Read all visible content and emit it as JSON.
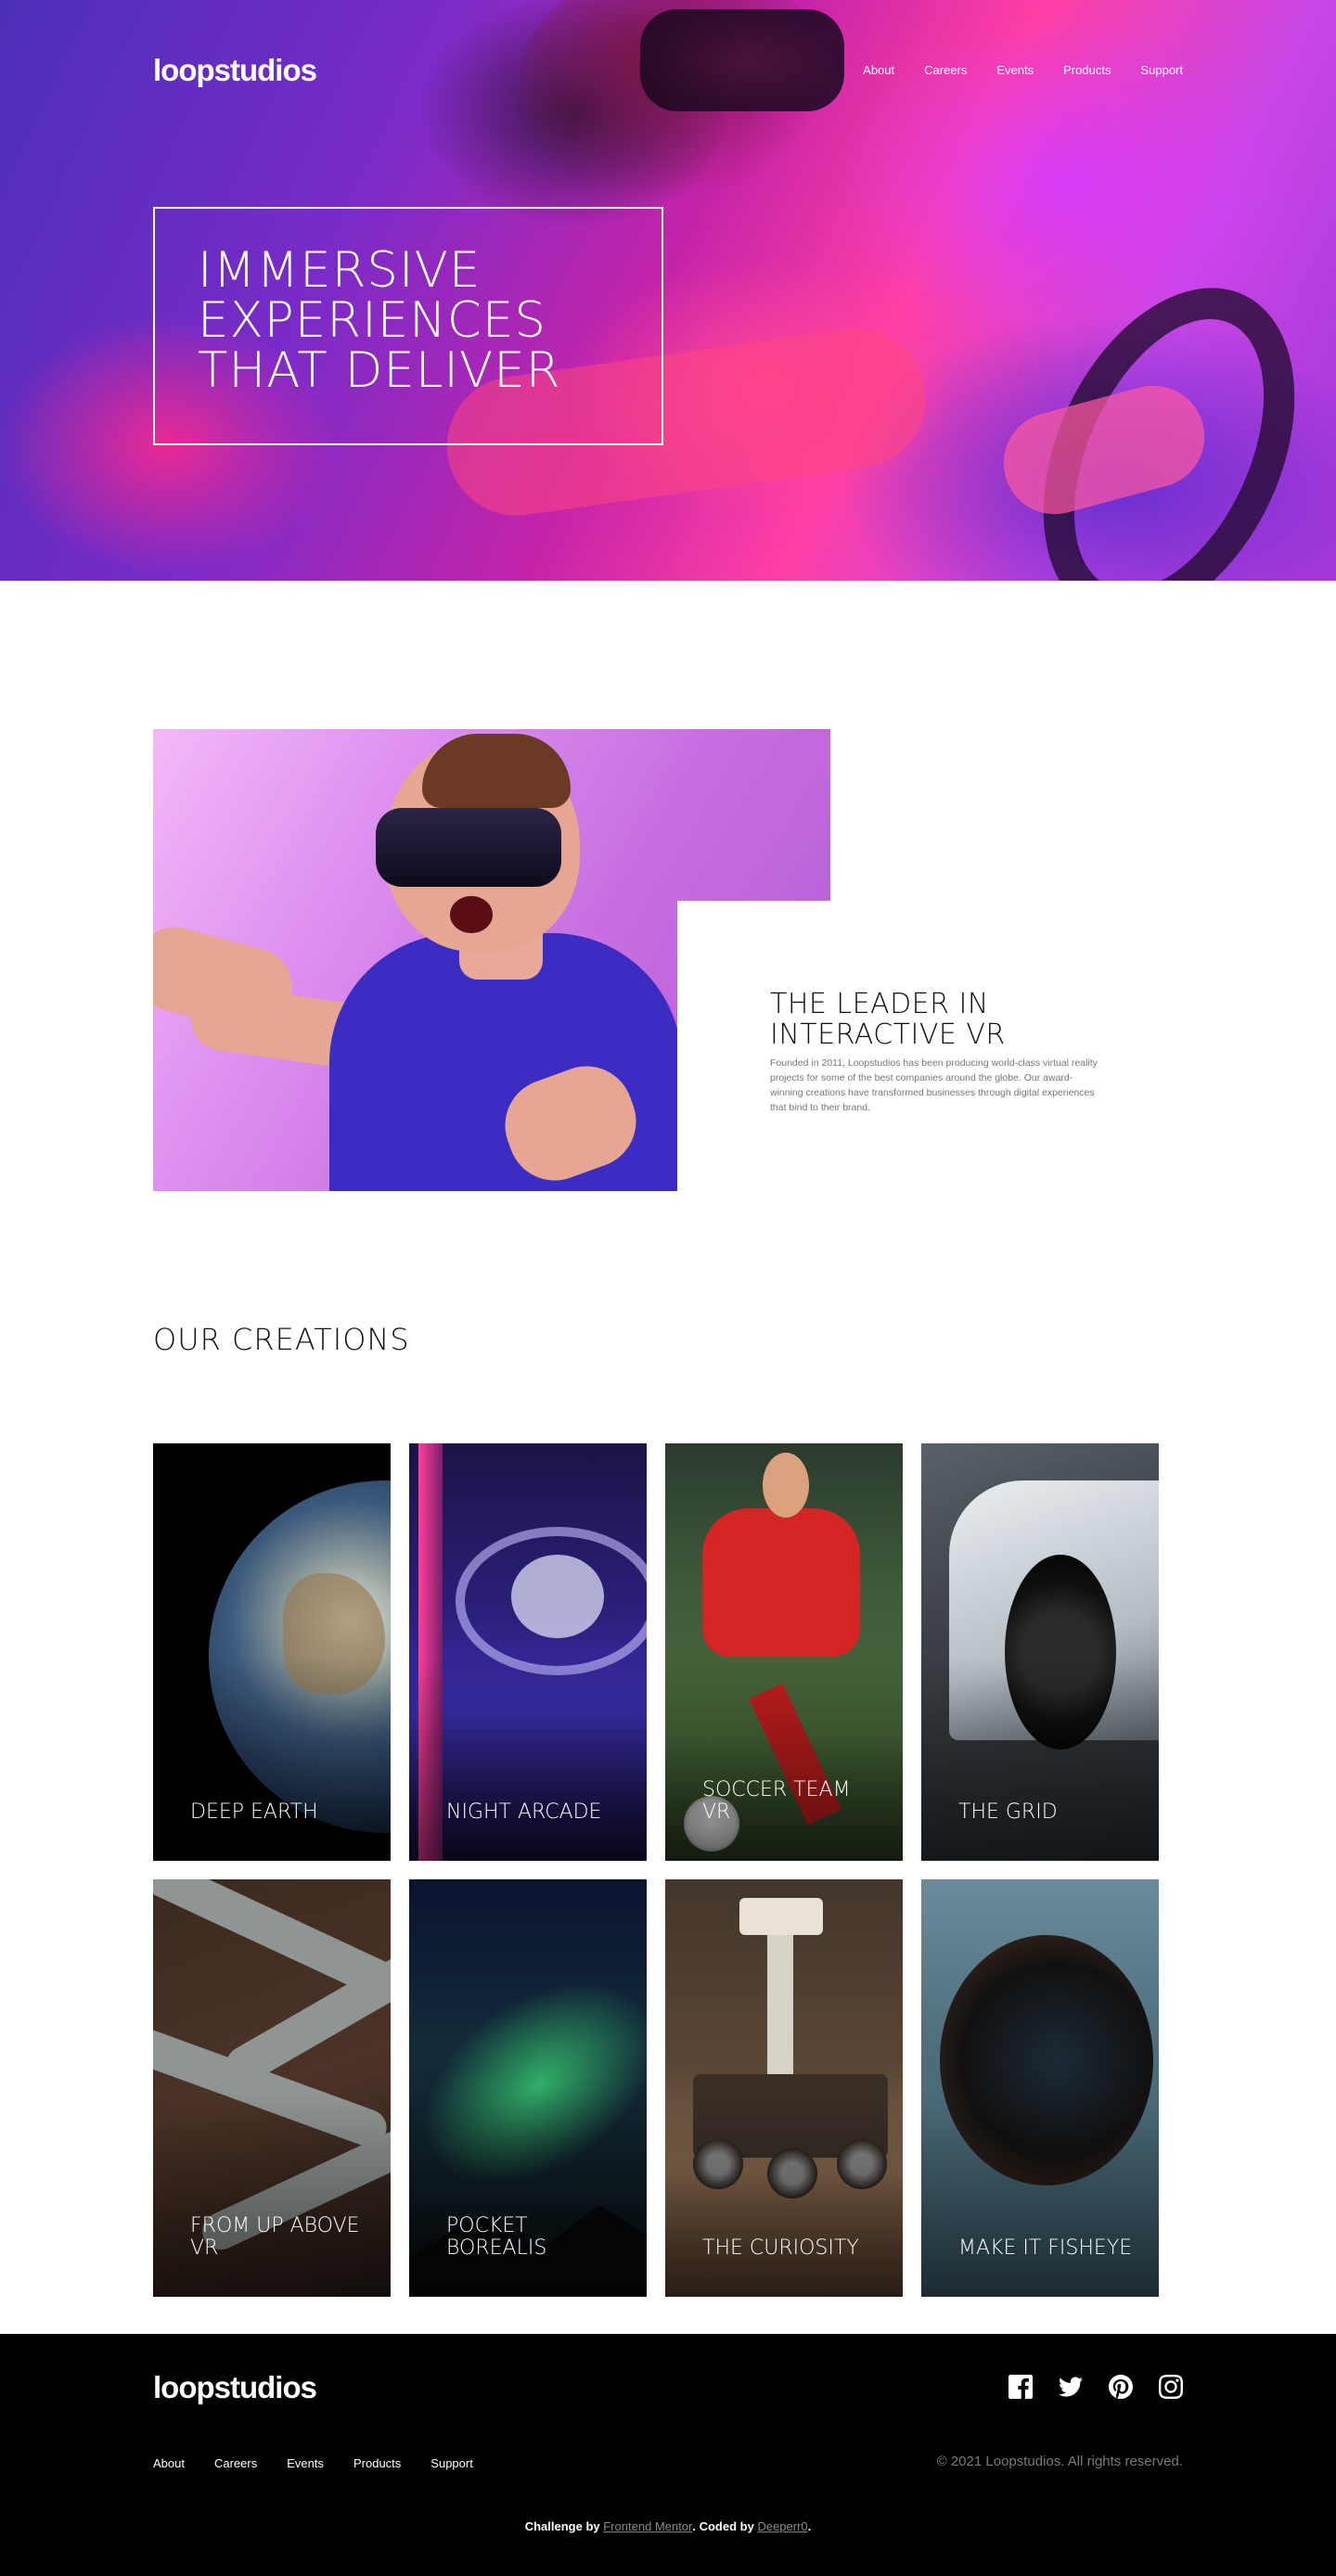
{
  "header": {
    "logo": "loopstudios",
    "nav": [
      "About",
      "Careers",
      "Events",
      "Products",
      "Support"
    ]
  },
  "hero": {
    "title": "Immersive experiences that deliver"
  },
  "about": {
    "title": "The leader in interactive VR",
    "text": "Founded in 2011, Loopstudios has been producing world-class virtual reality projects for some of the best companies around the globe. Our award-winning creations have transformed businesses through digital experiences that bind to their brand."
  },
  "creations": {
    "title": "Our creations",
    "items": [
      {
        "label": "Deep earth"
      },
      {
        "label": "Night arcade"
      },
      {
        "label": "Soccer team VR"
      },
      {
        "label": "The grid"
      },
      {
        "label": "From up above VR"
      },
      {
        "label": "Pocket borealis"
      },
      {
        "label": "The curiosity"
      },
      {
        "label": "Make it fisheye"
      }
    ]
  },
  "footer": {
    "logo": "loopstudios",
    "nav": [
      "About",
      "Careers",
      "Events",
      "Products",
      "Support"
    ],
    "social_icons": [
      "facebook-icon",
      "twitter-icon",
      "pinterest-icon",
      "instagram-icon"
    ],
    "copyright": "© 2021 Loopstudios. All rights reserved.",
    "attribution": {
      "challenge_prefix": "Challenge by",
      "challenge_link": "Frontend Mentor",
      "coded_prefix": ". Coded by",
      "coded_link": "Deeperr0",
      "suffix": "."
    }
  }
}
